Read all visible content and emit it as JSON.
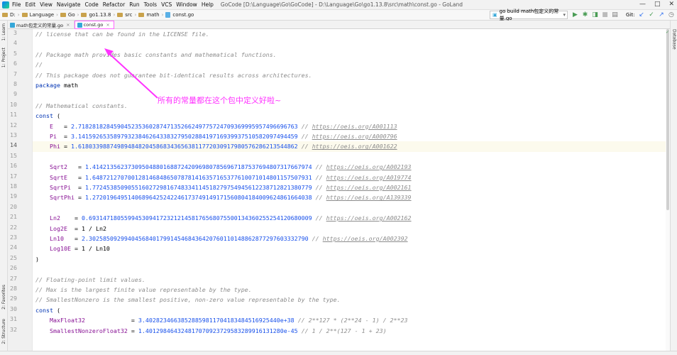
{
  "menubar": {
    "items": [
      "File",
      "Edit",
      "View",
      "Navigate",
      "Code",
      "Refactor",
      "Run",
      "Tools",
      "VCS",
      "Window",
      "Help"
    ],
    "window_title": "GoCode [D:\\Language\\Go\\GoCode] - D:\\Language\\Go\\go1.13.8\\src\\math\\const.go - GoLand",
    "controls": [
      "—",
      "□",
      "✕"
    ]
  },
  "navbar": {
    "crumbs": [
      "D:",
      "Language",
      "Go",
      "go1.13.8",
      "src",
      "math",
      "const.go"
    ],
    "run_config": "go build math包定义的常量.go",
    "git_label": "Git:"
  },
  "left_tool_tabs": [
    "1: Learn",
    "1: Project",
    "2: Favorites",
    "2: Structure"
  ],
  "right_tool_tabs": [
    "Database"
  ],
  "tabs": [
    {
      "label": "math包定义的常量.go",
      "active": false
    },
    {
      "label": "const.go",
      "active": true
    }
  ],
  "line_numbers": [
    "3",
    "4",
    "5",
    "6",
    "7",
    "8",
    "9",
    "10",
    "11",
    "12",
    "13",
    "14",
    "15",
    "16",
    "17",
    "18",
    "19",
    "20",
    "21",
    "22",
    "23",
    "24",
    "25",
    "26",
    "27",
    "28",
    "29",
    "30",
    "31",
    "32"
  ],
  "current_line": "14",
  "code": {
    "l3": "// license that can be found in the LICENSE file.",
    "l5": "// Package math provides basic constants and mathematical functions.",
    "l6": "//",
    "l7": "// This package does not guarantee bit-identical results across architectures.",
    "l8_kw": "package",
    "l8_id": "math",
    "l10": "// Mathematical constants.",
    "l11_kw": "const",
    "l11_p": " (",
    "l12_id": "E  ",
    "l12_val": "2.71828182845904523536028747135266249775724709369995957496696763",
    "l12_url": "https://oeis.org/A001113",
    "l13_id": "Pi ",
    "l13_val": "3.14159265358979323846264338327950288419716939937510582097494459",
    "l13_url": "https://oeis.org/A000796",
    "l14_id": "Phi",
    "l14_val": "1.61803398874989484820458683436563811772030917980576286213544862",
    "l14_url": "https://oeis.org/A001622",
    "l16_id": "Sqrt2  ",
    "l16_val": "1.41421356237309504880168872420969807856967187537694807317667974",
    "l16_url": "https://oeis.org/A002193",
    "l17_id": "SqrtE  ",
    "l17_val": "1.64872127070012814684865078781416357165377610071014801157507931",
    "l17_url": "https://oeis.org/A019774",
    "l18_id": "SqrtPi ",
    "l18_val": "1.77245385090551602729816748334114518279754945612238712821380779",
    "l18_url": "https://oeis.org/A002161",
    "l19_id": "SqrtPhi",
    "l19_val": "1.27201964951406896425242246173749149171560804184009624861664038",
    "l19_url": "https://oeis.org/A139339",
    "l21_id": "Ln2   ",
    "l21_val": "0.693147180559945309417232121458176568075500134360255254120680009",
    "l21_url": "https://oeis.org/A002162",
    "l22_id": "Log2E ",
    "l22_rest": "1 / Ln2",
    "l23_id": "Ln10  ",
    "l23_val": "2.30258509299404568401799145468436420760110148862877297603332790",
    "l23_url": "https://oeis.org/A002392",
    "l24_id": "Log10E",
    "l24_rest": "1 / Ln10",
    "l25": ")",
    "l27": "// Floating-point limit values.",
    "l28": "// Max is the largest finite value representable by the type.",
    "l29": "// SmallestNonzero is the smallest positive, non-zero value representable by the type.",
    "l30_kw": "const",
    "l30_p": " (",
    "l31_id": "MaxFloat32            ",
    "l31_val": "3.40282346638528859811704183484516925440e+38",
    "l31_cm": "// 2**127 * (2**24 - 1) / 2**23",
    "l32_id": "SmallestNonzeroFloat32",
    "l32_val": "1.401298464324817070923729583289916131280e-45",
    "l32_cm": "// 1 / 2**(127 - 1 + 23)"
  },
  "annotation": {
    "text": "所有的常量都在这个包中定义好啦~",
    "color": "#ff33ff"
  },
  "colors": {
    "comment": "#8c8c8c",
    "keyword": "#0033b3",
    "constant": "#871094",
    "number": "#1750eb",
    "current_line_bg": "#fcfaed"
  }
}
